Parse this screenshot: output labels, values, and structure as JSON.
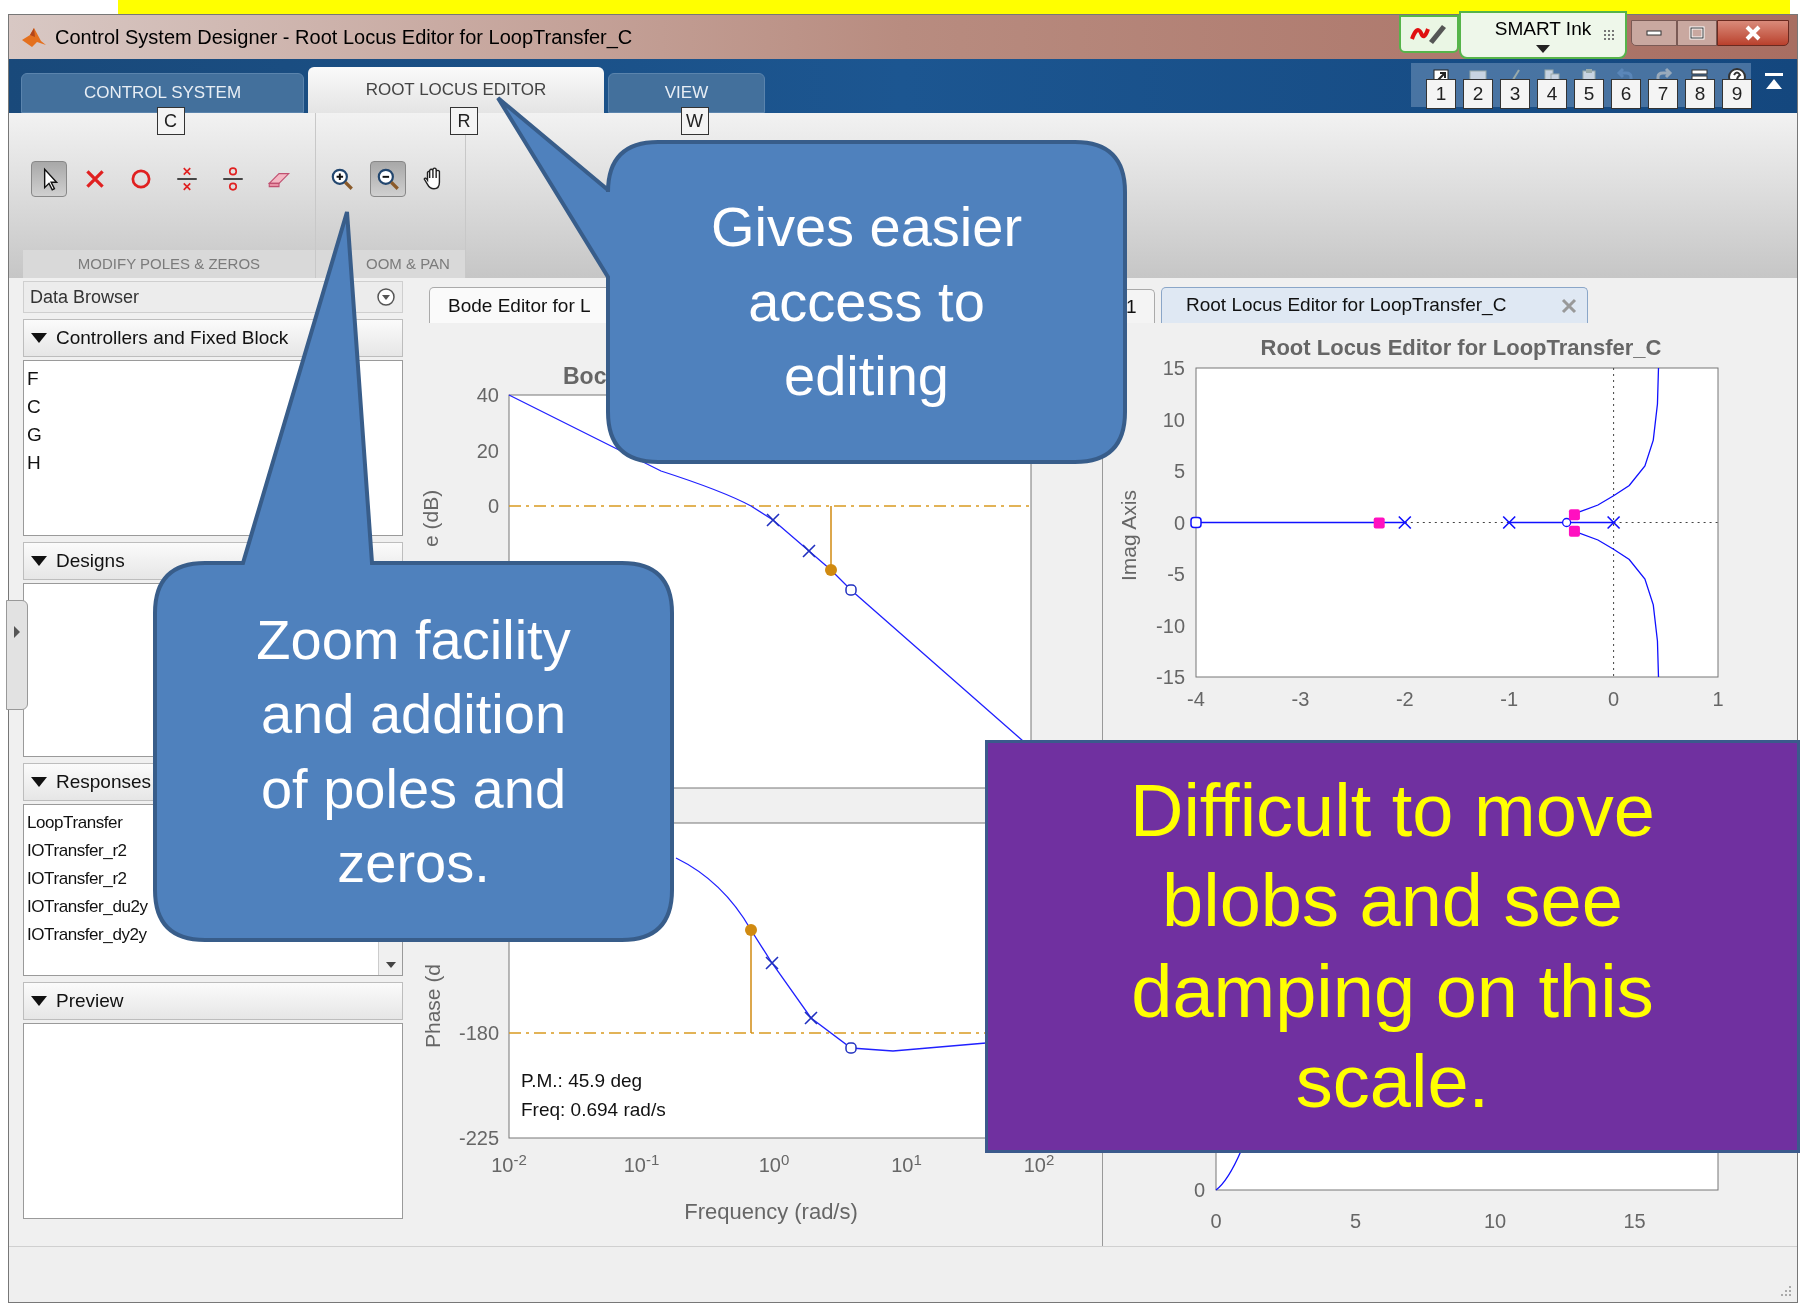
{
  "window": {
    "title": "Control System Designer - Root Locus Editor for LoopTransfer_C",
    "smart_ink": "SMART Ink"
  },
  "ribbon": {
    "tabs": [
      {
        "label": "CONTROL SYSTEM",
        "keytip": "C",
        "selected": false
      },
      {
        "label": "ROOT LOCUS EDITOR",
        "keytip": "R",
        "selected": true
      },
      {
        "label": "VIEW",
        "keytip": "W",
        "selected": false
      }
    ],
    "quick_access_keytips": [
      "1",
      "2",
      "3",
      "4",
      "5",
      "6",
      "7",
      "8",
      "9"
    ],
    "tools": [
      {
        "kind": "pointer",
        "selected": true
      },
      {
        "kind": "delete",
        "selected": false
      },
      {
        "kind": "zero",
        "selected": false
      },
      {
        "kind": "pole_pair",
        "selected": false
      },
      {
        "kind": "zero_pair",
        "selected": false
      },
      {
        "kind": "eraser",
        "selected": false
      },
      {
        "kind": "zoom_in",
        "selected": false
      },
      {
        "kind": "zoom_out",
        "selected": true
      },
      {
        "kind": "pan",
        "selected": false
      }
    ],
    "sections": [
      "MODIFY POLES & ZEROS",
      "OOM & PAN"
    ]
  },
  "data_browser": {
    "title": "Data Browser",
    "sections": [
      {
        "label": "Controllers and Fixed Block",
        "items": [
          "F",
          "C",
          "G",
          "H"
        ]
      },
      {
        "label": "Designs"
      },
      {
        "label": "Responses",
        "items": [
          "LoopTransfer",
          "IOTransfer_r2",
          "IOTransfer_r2",
          "IOTransfer_du2y",
          "IOTransfer_dy2y"
        ]
      },
      {
        "label": "Preview"
      }
    ]
  },
  "bode_panel": {
    "tab": "Bode Editor for L",
    "title": "Boc",
    "magnitude_ylabel": "e (dB)",
    "magnitude_yticks": [
      "40",
      "20",
      "0"
    ],
    "phase_ylabel": "Phase (d",
    "phase_yticks": [
      "-180",
      "-225"
    ],
    "xticks": [
      "10$^{-2}$",
      "10$^{-1}$",
      "10$^{0}$",
      "10$^{1}$",
      "10$^{2}$"
    ],
    "xlabel": "Frequency (rad/s)",
    "margins": [
      "P.M.: 45.9 deg",
      "Freq: 0.694 rad/s"
    ]
  },
  "root_locus_panel": {
    "tab_fragment": "1",
    "tab": "Root Locus Editor for LoopTransfer_C",
    "title": "Root Locus Editor for LoopTransfer_C",
    "ylabel": "Imag Axis",
    "yticks": [
      "15",
      "10",
      "5",
      "0",
      "-5",
      "-10",
      "-15"
    ],
    "xticks": [
      "-4",
      "-3",
      "-2",
      "-1",
      "0",
      "1"
    ]
  },
  "step_panel": {
    "yticks": [
      "0"
    ],
    "xticks": [
      "0",
      "5",
      "10",
      "15"
    ]
  },
  "callouts": [
    {
      "text": "Gives easier access to editing"
    },
    {
      "text": "Zoom facility and addition of poles and zeros."
    }
  ],
  "note": {
    "text": "Difficult to move blobs and see damping on this scale."
  }
}
